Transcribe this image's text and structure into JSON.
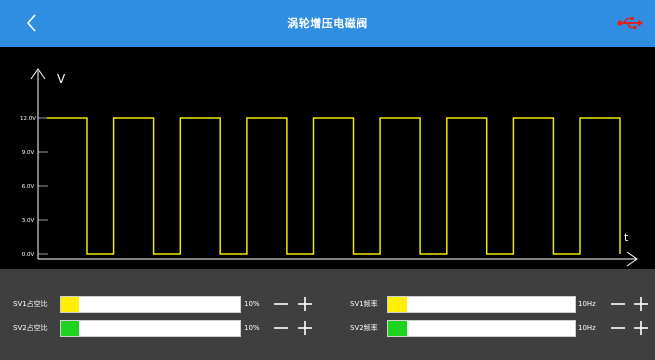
{
  "header": {
    "title": "涡轮增压电磁阀",
    "back_icon": "chevron-left-icon",
    "status_icon": "usb-icon",
    "accent_color": "#2f8ee2",
    "usb_color": "#e0211f"
  },
  "chart_data": {
    "type": "line",
    "title": "",
    "ylabel": "V",
    "xlabel": "t",
    "ylim": [
      0,
      12
    ],
    "y_ticks": [
      "0.0V",
      "3.0V",
      "6.0V",
      "9.0V",
      "12.0V"
    ],
    "line_color": "#f2e600",
    "grid": false,
    "series": [
      {
        "values": [
          {
            "t": 0.0,
            "v": 12
          },
          {
            "t": 0.6,
            "v": 12
          },
          {
            "t": 0.6,
            "v": 0
          },
          {
            "t": 1.0,
            "v": 0
          },
          {
            "t": 1.0,
            "v": 12
          },
          {
            "t": 1.6,
            "v": 12
          },
          {
            "t": 1.6,
            "v": 0
          },
          {
            "t": 2.0,
            "v": 0
          },
          {
            "t": 2.0,
            "v": 12
          },
          {
            "t": 2.6,
            "v": 12
          },
          {
            "t": 2.6,
            "v": 0
          },
          {
            "t": 3.0,
            "v": 0
          },
          {
            "t": 3.0,
            "v": 12
          },
          {
            "t": 3.6,
            "v": 12
          },
          {
            "t": 3.6,
            "v": 0
          },
          {
            "t": 4.0,
            "v": 0
          },
          {
            "t": 4.0,
            "v": 12
          },
          {
            "t": 4.6,
            "v": 12
          },
          {
            "t": 4.6,
            "v": 0
          },
          {
            "t": 5.0,
            "v": 0
          },
          {
            "t": 5.0,
            "v": 12
          },
          {
            "t": 5.6,
            "v": 12
          },
          {
            "t": 5.6,
            "v": 0
          },
          {
            "t": 6.0,
            "v": 0
          },
          {
            "t": 6.0,
            "v": 12
          },
          {
            "t": 6.6,
            "v": 12
          },
          {
            "t": 6.6,
            "v": 0
          },
          {
            "t": 7.0,
            "v": 0
          },
          {
            "t": 7.0,
            "v": 12
          },
          {
            "t": 7.6,
            "v": 12
          },
          {
            "t": 7.6,
            "v": 0
          },
          {
            "t": 8.0,
            "v": 0
          },
          {
            "t": 8.0,
            "v": 12
          },
          {
            "t": 8.6,
            "v": 12
          },
          {
            "t": 8.6,
            "v": 0
          }
        ]
      }
    ]
  },
  "controls": {
    "rows": [
      {
        "label": "SV1占空比",
        "value": "10%",
        "percent": 0.1,
        "color": "#ffef00",
        "minus": "−",
        "plus": "+"
      },
      {
        "label": "SV2占空比",
        "value": "10%",
        "percent": 0.1,
        "color": "#1ed31e",
        "minus": "−",
        "plus": "+"
      },
      {
        "label": "SV1频率",
        "value": "10Hz",
        "percent": 0.1,
        "color": "#ffef00",
        "minus": "−",
        "plus": "+"
      },
      {
        "label": "SV2频率",
        "value": "10Hz",
        "percent": 0.1,
        "color": "#1ed31e",
        "minus": "−",
        "plus": "+"
      }
    ]
  }
}
